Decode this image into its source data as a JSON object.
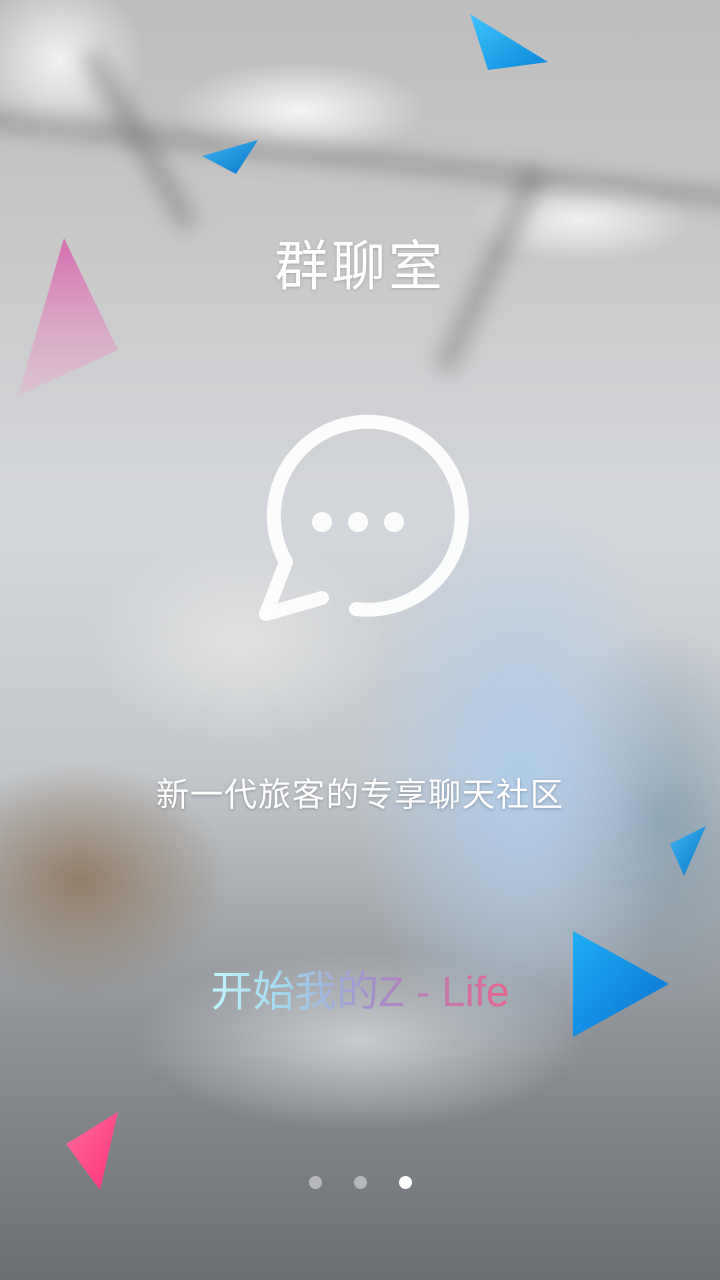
{
  "page": {
    "title": "群聊室",
    "tagline": "新一代旅客的专享聊天社区",
    "start_label": "开始我的Z - Life"
  },
  "icons": {
    "chat": "chat-bubble-ellipsis-icon",
    "next": "play-arrow-icon"
  },
  "pager": {
    "count": 3,
    "active_index": 2
  },
  "colors": {
    "text": "#ffffff",
    "accent_blue": "#0a9be6",
    "accent_pink": "#ff4f8b",
    "start_gradient_from": "#bff6ff",
    "start_gradient_to": "#e9628f"
  }
}
